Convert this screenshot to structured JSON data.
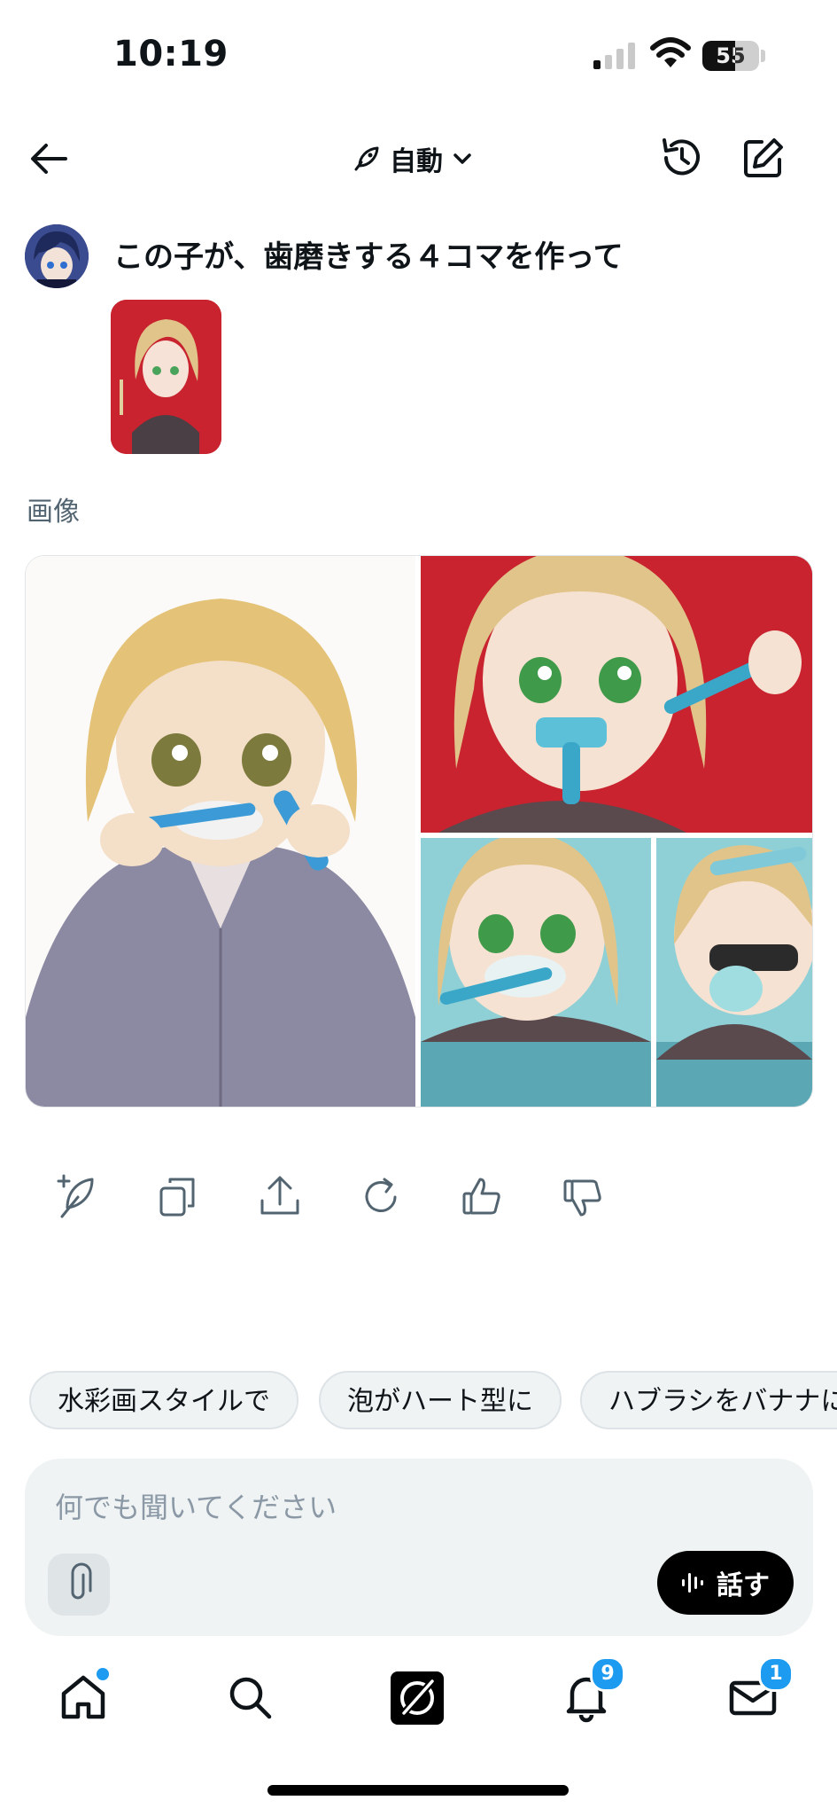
{
  "status_bar": {
    "time": "10:19",
    "battery": "55"
  },
  "header": {
    "mode_label": "自動"
  },
  "message": {
    "prompt": "この子が、歯磨きする４コマを作って"
  },
  "result": {
    "section_label": "画像"
  },
  "suggestions": [
    "水彩画スタイルで",
    "泡がハート型に",
    "ハブラシをバナナに"
  ],
  "input": {
    "placeholder": "何でも聞いてください",
    "speak_label": "話す"
  },
  "nav": {
    "notifications_badge": "9",
    "messages_badge": "1"
  },
  "colors": {
    "accent": "#1d9bf0",
    "text": "#0f1419",
    "muted": "#536471",
    "panel_red": "#c8232f"
  }
}
